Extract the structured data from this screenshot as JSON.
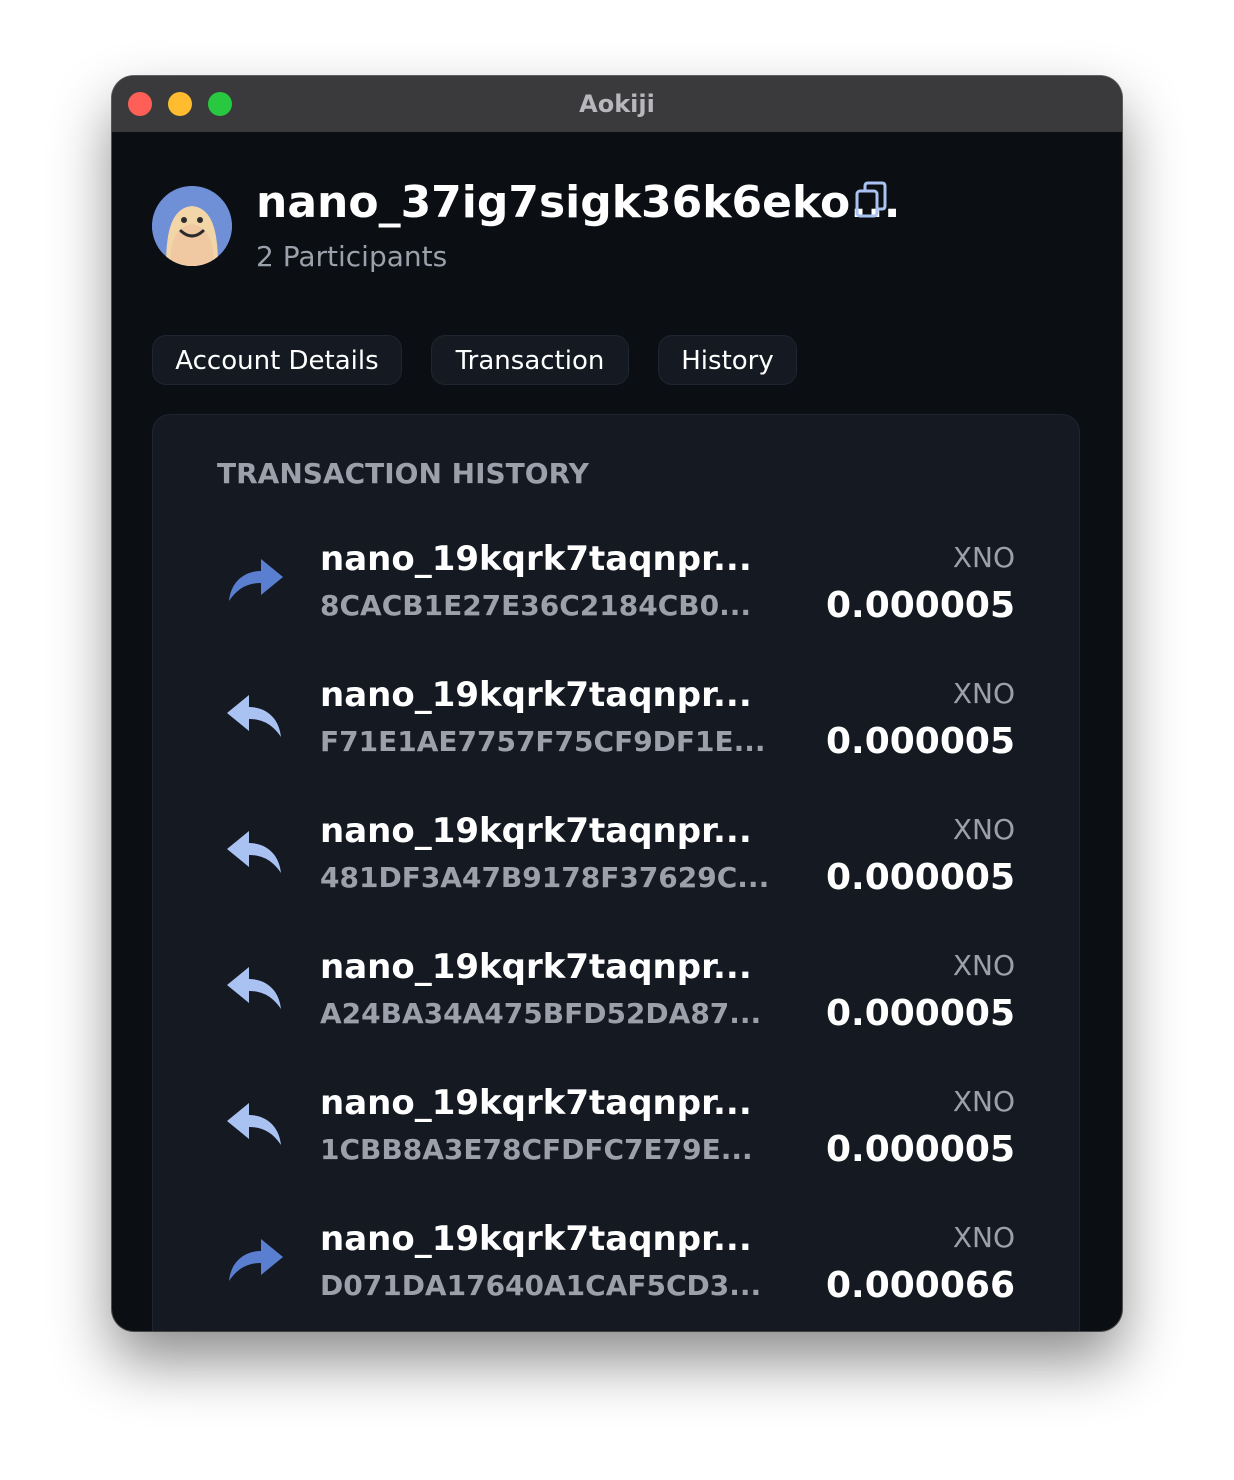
{
  "window": {
    "title": "Aokiji"
  },
  "account": {
    "name": "nano_37ig7sigk36k6eko...",
    "participants": "2 Participants",
    "avatar_icon": "smiley-face-avatar",
    "copy_icon": "copy-icon"
  },
  "tabs": [
    {
      "label": "Account Details"
    },
    {
      "label": "Transaction"
    },
    {
      "label": "History"
    }
  ],
  "history": {
    "title": "TRANSACTION HISTORY",
    "transactions": [
      {
        "direction": "send",
        "icon": "send-arrow-icon",
        "address": "nano_19kqrk7taqnpr...",
        "hash": "8CACB1E27E36C2184CB0...",
        "currency": "XNO",
        "amount": "0.000005"
      },
      {
        "direction": "receive",
        "icon": "receive-arrow-icon",
        "address": "nano_19kqrk7taqnpr...",
        "hash": "F71E1AE7757F75CF9DF1E...",
        "currency": "XNO",
        "amount": "0.000005"
      },
      {
        "direction": "receive",
        "icon": "receive-arrow-icon",
        "address": "nano_19kqrk7taqnpr...",
        "hash": "481DF3A47B9178F37629C...",
        "currency": "XNO",
        "amount": "0.000005"
      },
      {
        "direction": "receive",
        "icon": "receive-arrow-icon",
        "address": "nano_19kqrk7taqnpr...",
        "hash": "A24BA34A475BFD52DA87...",
        "currency": "XNO",
        "amount": "0.000005"
      },
      {
        "direction": "receive",
        "icon": "receive-arrow-icon",
        "address": "nano_19kqrk7taqnpr...",
        "hash": "1CBB8A3E78CFDFC7E79E...",
        "currency": "XNO",
        "amount": "0.000005"
      },
      {
        "direction": "send",
        "icon": "send-arrow-icon",
        "address": "nano_19kqrk7taqnpr...",
        "hash": "D071DA17640A1CAF5CD3...",
        "currency": "XNO",
        "amount": "0.000066"
      }
    ]
  },
  "colors": {
    "background": "#0b0e12",
    "panel": "#141922",
    "send_arrow": "#5b7fd0",
    "receive_arrow": "#a9c2f2",
    "text_primary": "#ffffff",
    "text_secondary": "#9ba1ab"
  }
}
